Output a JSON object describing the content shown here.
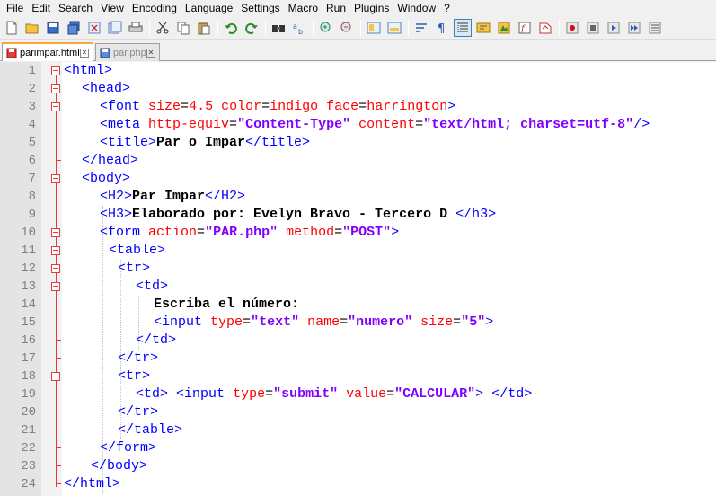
{
  "menu": [
    "File",
    "Edit",
    "Search",
    "View",
    "Encoding",
    "Language",
    "Settings",
    "Macro",
    "Run",
    "Plugins",
    "Window",
    "?"
  ],
  "toolbar": {
    "icons": [
      "new-file-icon",
      "open-file-icon",
      "save-icon",
      "save-all-icon",
      "close-icon",
      "close-all-icon",
      "print-icon",
      "cut-icon",
      "copy-icon",
      "paste-icon",
      "undo-icon",
      "redo-icon",
      "find-icon",
      "replace-icon",
      "zoom-in-icon",
      "zoom-out-icon",
      "sync-vertical-icon",
      "sync-horizontal-icon",
      "word-wrap-icon",
      "show-all-chars-icon",
      "indent-guide-icon",
      "user-lang-icon",
      "doc-map-icon",
      "function-list-icon",
      "folder-workspace-icon",
      "record-macro-icon",
      "stop-record-icon",
      "play-macro-icon",
      "play-multiple-icon",
      "save-macro-icon"
    ]
  },
  "tabs": [
    {
      "label": "parimpar.html",
      "active": true
    },
    {
      "label": "par.php",
      "active": false
    }
  ],
  "lines": [
    "1",
    "2",
    "3",
    "4",
    "5",
    "6",
    "7",
    "8",
    "9",
    "10",
    "11",
    "12",
    "13",
    "14",
    "15",
    "16",
    "17",
    "18",
    "19",
    "20",
    "21",
    "22",
    "23",
    "24"
  ],
  "code": {
    "l1": {
      "t1": "<html>"
    },
    "l2": {
      "t1": "<head>"
    },
    "l3": {
      "t1": "<font",
      "a1": "size",
      "eq1": "=",
      "v1": "4.5",
      "a2": "color",
      "eq2": "=",
      "v2": "indigo",
      "a3": "face",
      "eq3": "=",
      "v3": "harrington",
      "t2": ">"
    },
    "l4": {
      "t1": "<meta",
      "a1": "http-equiv",
      "eq1": "=",
      "s1": "\"Content-Type\"",
      "a2": "content",
      "eq2": "=",
      "s2": "\"text/html; charset=utf-8\"",
      "t2": "/>"
    },
    "l5": {
      "t1": "<title>",
      "x1": "Par o Impar",
      "t2": "</title>"
    },
    "l6": {
      "t1": "</head>"
    },
    "l7": {
      "t1": "<body>"
    },
    "l8": {
      "t1": "<H2>",
      "x1": "Par Impar",
      "t2": "</H2>"
    },
    "l9": {
      "t1": "<H3>",
      "x1": "Elaborado por: Evelyn Bravo - Tercero D ",
      "t2": "</h3>"
    },
    "l10": {
      "t1": "<form",
      "a1": "action",
      "eq1": "=",
      "s1": "\"PAR.php\"",
      "a2": "method",
      "eq2": "=",
      "s2": "\"POST\"",
      "t2": ">"
    },
    "l11": {
      "t1": "<table>"
    },
    "l12": {
      "t1": "<tr>"
    },
    "l13": {
      "t1": "<td>"
    },
    "l14": {
      "x1": "Escriba el número:"
    },
    "l15": {
      "t1": "<input",
      "a1": "type",
      "eq1": "=",
      "s1": "\"text\"",
      "a2": "name",
      "eq2": "=",
      "s2": "\"numero\"",
      "a3": "size",
      "eq3": "=",
      "s3": "\"5\"",
      "t2": ">"
    },
    "l16": {
      "t1": "</td>"
    },
    "l17": {
      "t1": "</tr>"
    },
    "l18": {
      "t1": "<tr>"
    },
    "l19": {
      "t1": "<td>",
      "t2": "<input",
      "a1": "type",
      "eq1": "=",
      "s1": "\"submit\"",
      "a2": "value",
      "eq2": "=",
      "s2": "\"CALCULAR\"",
      "t3": ">",
      "t4": "</td>"
    },
    "l20": {
      "t1": "</tr>"
    },
    "l21": {
      "t1": "</table>"
    },
    "l22": {
      "t1": "</form>"
    },
    "l23": {
      "t1": "</body>"
    },
    "l24": {
      "t1": "</html>"
    }
  },
  "colors": {
    "tag": "#0000ff",
    "attr": "#ff0000",
    "string": "#8000ff",
    "fold": "#e53b3b",
    "active_tab_accent": "#f9a83b"
  }
}
